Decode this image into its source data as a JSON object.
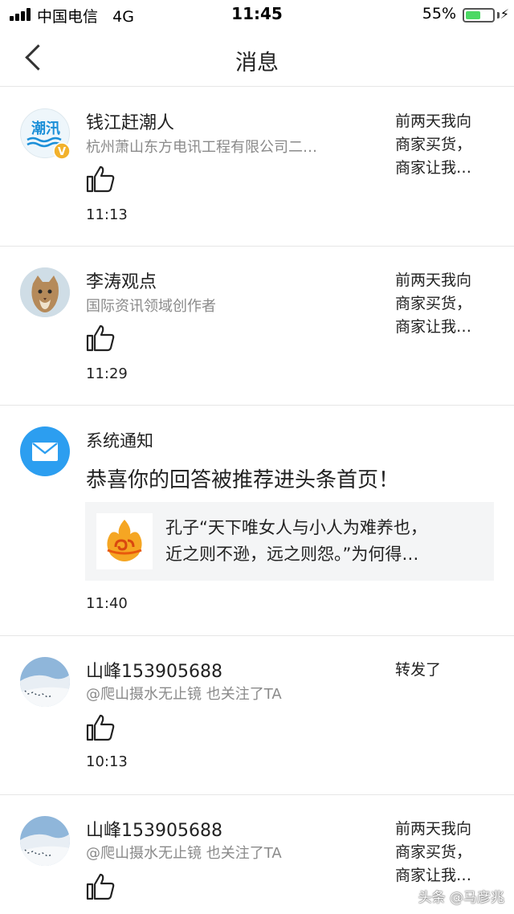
{
  "status_bar": {
    "carrier": "中国电信",
    "network": "4G",
    "time": "11:45",
    "battery_percent": "55%",
    "battery_level": 0.55
  },
  "header": {
    "title": "消息"
  },
  "messages": [
    {
      "name": "钱江赶潮人",
      "subtitle": "杭州萧山东方电讯工程有限公司二…",
      "time": "11:13",
      "side_lines": [
        "前两天我向",
        "商家买货，",
        "商家让我…"
      ],
      "avatar_text": "潮汛",
      "verified_badge": "V"
    },
    {
      "name": "李涛观点",
      "subtitle": "国际资讯领域创作者",
      "time": "11:29",
      "side_lines": [
        "前两天我向",
        "商家买货，",
        "商家让我…"
      ]
    },
    {
      "name": "山峰153905688",
      "subtitle": "@爬山摄水无止镜 也关注了TA",
      "time": "10:13",
      "side_lines": [
        "转发了"
      ]
    },
    {
      "name": "山峰153905688",
      "subtitle": "@爬山摄水无止镜 也关注了TA",
      "side_lines": [
        "前两天我向",
        "商家买货，",
        "商家让我…"
      ]
    }
  ],
  "system_notice": {
    "title": "系统通知",
    "text": "恭喜你的回答被推荐进头条首页！",
    "quote_line1": "孔子“天下唯女人与小人为难养也，",
    "quote_line2": "近之则不逊，远之则怨。”为何得…",
    "time": "11:40"
  },
  "watermark": "头条 @马彦兆",
  "colors": {
    "system_icon": "#2c9ef0",
    "battery": "#4cd964",
    "secondary_text": "#8a8a8a",
    "divider": "#e6e6e6"
  }
}
